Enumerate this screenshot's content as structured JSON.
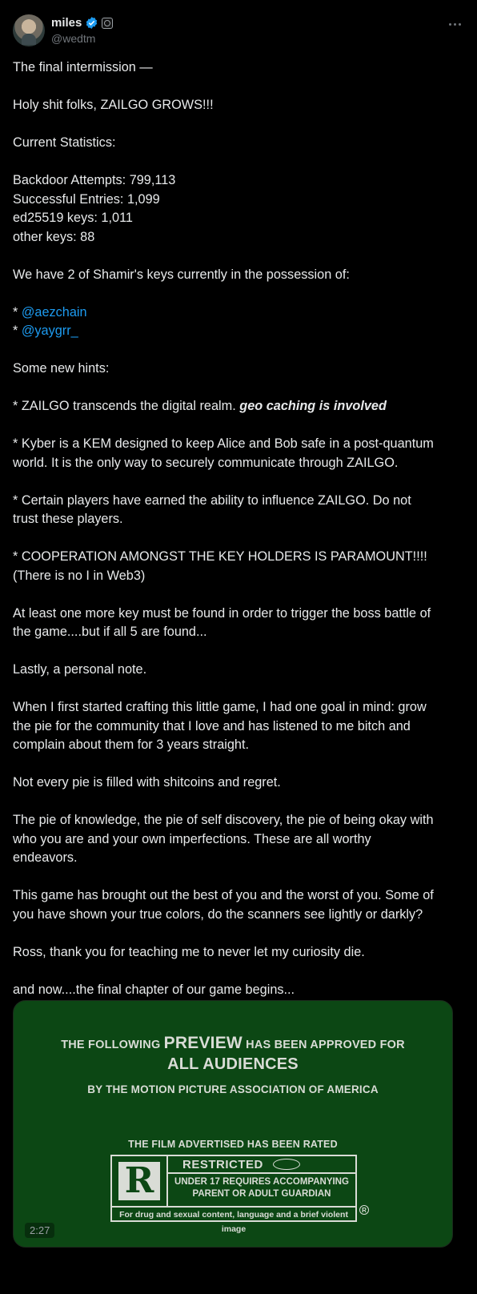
{
  "author": {
    "display_name": "miles",
    "handle": "@wedtm"
  },
  "icons": [
    "verified-badge-icon",
    "affiliate-badge-icon",
    "more-icon"
  ],
  "colors": {
    "link": "#1d9bf0",
    "background": "#000000",
    "media_bg": "#0c4714"
  },
  "post": {
    "lines": [
      "The final intermission —",
      "Holy shit folks, ZAILGO GROWS!!!",
      "Current Statistics:",
      "Backdoor Attempts: 799,113",
      "Successful Entries: 1,099",
      "ed25519 keys: 1,011",
      "other keys: 88",
      "We have 2 of Shamir's keys currently in the possession of:",
      "* ",
      "@aezchain",
      "* ",
      "@yaygrr_",
      "Some new hints:",
      "* ZAILGO transcends the digital realm. ",
      "geo caching is involved",
      "* Kyber is a KEM designed to keep Alice and Bob safe in a post-quantum",
      "world. It is the only way to securely communicate through ZAILGO.",
      "* Certain players have earned the ability to influence ZAILGO. Do not",
      "trust these players.",
      "* COOPERATION AMONGST THE KEY HOLDERS IS PARAMOUNT!!!!",
      "(There is no I in Web3)",
      "At least one more key must be found in order to trigger the boss battle of",
      "the game....but if all 5 are found...",
      "Lastly, a personal note.",
      "When I first started crafting this little game, I had one goal in mind: grow",
      "the pie for the community that I love and has listened to me bitch and",
      "complain about them for 3 years straight.",
      "Not every pie is filled with shitcoins and regret.",
      "The pie of knowledge, the pie of self discovery, the pie of being okay with",
      "who you are and your own imperfections. These are all worthy",
      "endeavors.",
      "This game has brought out the best of you and the worst of you. Some of",
      "you have shown your true colors, do the scanners see lightly or darkly?",
      "Ross, thank you for teaching me to never let my curiosity die.",
      "and now....the final chapter of our game begins..."
    ]
  },
  "media": {
    "line1_a": "THE FOLLOWING",
    "line1_b": "PREVIEW",
    "line1_c": "HAS BEEN APPROVED FOR",
    "line2": "ALL AUDIENCES",
    "line3": "BY THE MOTION PICTURE ASSOCIATION OF AMERICA",
    "line4": "THE FILM ADVERTISED HAS BEEN RATED",
    "rating_letter": "R",
    "rating_title": "RESTRICTED",
    "rating_sub1": "UNDER 17 REQUIRES ACCOMPANYING",
    "rating_sub2": "PARENT OR ADULT GUARDIAN",
    "rating_reason": "For drug and sexual content, language and a brief violent image",
    "registered": "R",
    "duration": "2:27"
  }
}
